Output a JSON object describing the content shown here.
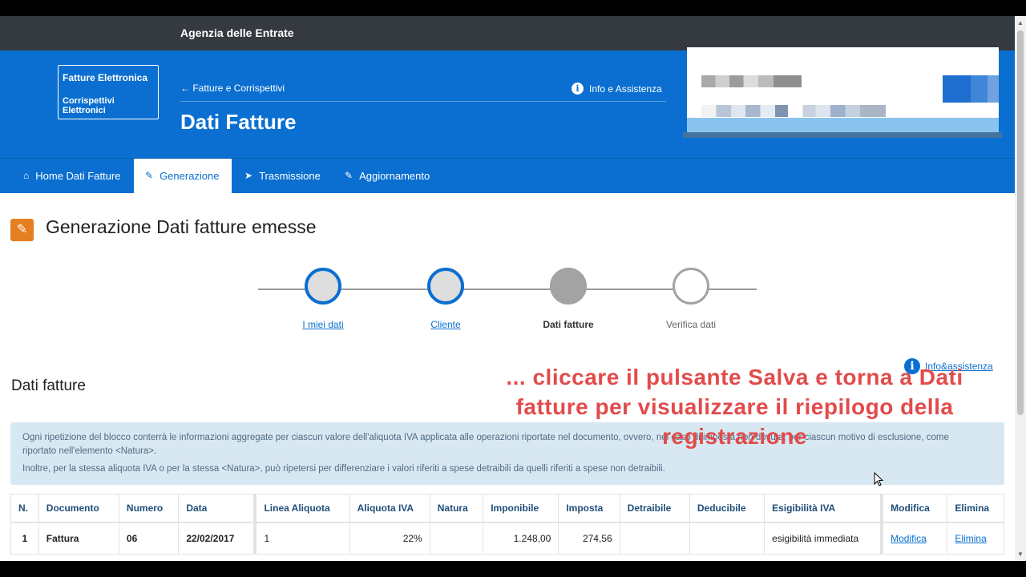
{
  "topbar": {
    "agency": "Agenzia delle Entrate"
  },
  "header": {
    "logo_line1": "Fatture Elettronica",
    "logo_line2": "Corrispettivi Elettronici",
    "back_link": "Fatture e Corrispettivi",
    "info_link": "Info e Assistenza",
    "title": "Dati Fatture"
  },
  "nav": {
    "items": [
      {
        "label": "Home Dati Fatture",
        "icon": "home-icon"
      },
      {
        "label": "Generazione",
        "icon": "pencil-icon"
      },
      {
        "label": "Trasmissione",
        "icon": "send-icon"
      },
      {
        "label": "Aggiornamento",
        "icon": "pencil-icon"
      }
    ],
    "active": "Generazione"
  },
  "content": {
    "title": "Generazione Dati fatture emesse",
    "steps": [
      {
        "label": "I miei dati",
        "state": "done"
      },
      {
        "label": "Cliente",
        "state": "done"
      },
      {
        "label": "Dati fatture",
        "state": "current"
      },
      {
        "label": "Verifica dati",
        "state": "pending"
      }
    ],
    "info_assist": "Info&assistenza",
    "section_title": "Dati fatture",
    "overlay": "... cliccare il pulsante Salva e torna a Dati fatture per visualizzare il riepilogo della registrazione",
    "alert_p1": "Ogni ripetizione del blocco conterrà le informazioni aggregate per ciascun valore dell'aliquota IVA applicata alle operazioni riportate nel documento, ovvero, nel caso di imposta non dovuta, per ciascun motivo di esclusione, come riportato nell'elemento <Natura>.",
    "alert_p2": "Inoltre, per la stessa aliquota IVA o per la stessa <Natura>, può ripetersi per differenziare i valori riferiti a spese detraibili da quelli riferiti a spese non detraibili."
  },
  "table": {
    "headers": [
      "N.",
      "Documento",
      "Numero",
      "Data",
      "Linea Aliquota",
      "Aliquota IVA",
      "Natura",
      "Imponibile",
      "Imposta",
      "Detraibile",
      "Deducibile",
      "Esigibilità IVA",
      "Modifica",
      "Elimina"
    ],
    "rows": [
      [
        "1",
        "Fattura",
        "06",
        "22/02/2017",
        "1",
        "22%",
        "",
        "1.248,00",
        "274,56",
        "",
        "",
        "esigibilità immediata",
        "Modifica",
        "Elimina"
      ]
    ]
  },
  "colors": {
    "brand_blue": "#0a6fd0",
    "topbar": "#343a40",
    "accent_orange": "#e67e22",
    "overlay_red": "#e24b4b"
  }
}
